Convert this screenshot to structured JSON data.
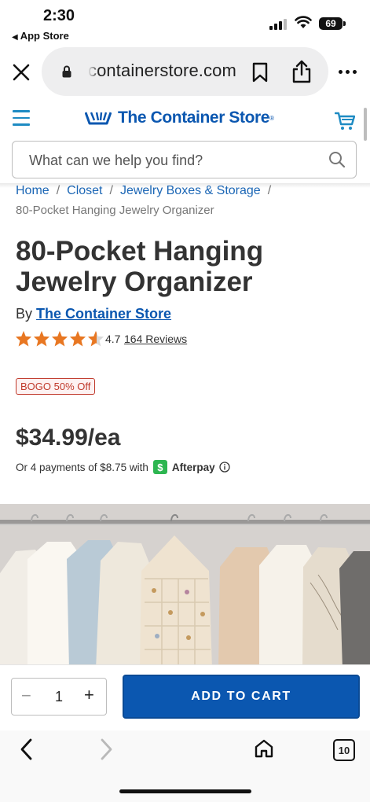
{
  "status_bar": {
    "time": "2:30",
    "back_app": "App Store",
    "battery": "69"
  },
  "browser": {
    "url": "containerstore.com",
    "icons": [
      "close-icon",
      "lock-icon",
      "bookmark-icon",
      "share-icon",
      "more-icon"
    ]
  },
  "site_header": {
    "logo_text": "The Container Store",
    "logo_mark": "®",
    "search_placeholder": "What can we help you find?",
    "brand_color": "#0b57b0",
    "accent_color": "#1e8bc3"
  },
  "breadcrumb": {
    "items": [
      "Home",
      "Closet",
      "Jewelry Boxes & Storage"
    ],
    "separator": "/",
    "current": "80-Pocket Hanging Jewelry Organizer"
  },
  "product": {
    "title_line1": "80-Pocket Hanging",
    "title_line2": "Jewelry Organizer",
    "by_label": "By",
    "brand": "The Container Store",
    "rating": 4.7,
    "rating_text": "4.7",
    "reviews": "164 Reviews",
    "promo": "BOGO 50% Off",
    "price": "$34.99/ea",
    "installments_text": "Or 4 payments of $8.75 with",
    "installment_provider": "Afterpay",
    "star_color": "#e87722"
  },
  "purchase": {
    "minus": "−",
    "quantity": "1",
    "plus": "+",
    "add_to_cart": "ADD TO CART",
    "button_color": "#0b57b0"
  },
  "toolbar": {
    "tab_count": "10"
  }
}
